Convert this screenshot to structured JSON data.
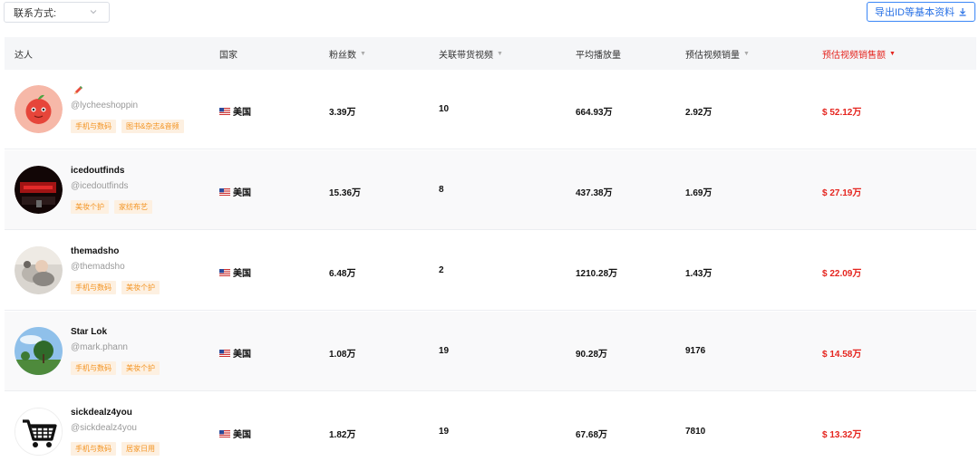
{
  "filter": {
    "contact_label": "联系方式:"
  },
  "export_label": "导出ID等基本资料",
  "columns": [
    {
      "label": "达人",
      "sortable": false
    },
    {
      "label": "国家",
      "sortable": false
    },
    {
      "label": "粉丝数",
      "sortable": true
    },
    {
      "label": "关联带货视频",
      "sortable": true
    },
    {
      "label": "平均播放量",
      "sortable": false
    },
    {
      "label": "预估视频销量",
      "sortable": true
    },
    {
      "label": "预估视频销售额",
      "sortable": true,
      "active": true
    }
  ],
  "sort_glyph": "▼",
  "rows": [
    {
      "name": "",
      "name_icon": "pencil-emoji-icon",
      "handle": "@lycheeshoppin",
      "tags": [
        "手机与数码",
        "图书&杂志&音频"
      ],
      "country": "美国",
      "followers": "3.39万",
      "videos": "10",
      "avg_views": "664.93万",
      "est_sales": "2.92万",
      "est_revenue": "$ 52.12万",
      "avatar": "lychee-avatar"
    },
    {
      "name": "icedoutfinds",
      "handle": "@icedoutfinds",
      "tags": [
        "美妆个护",
        "家纺布艺"
      ],
      "country": "美国",
      "followers": "15.36万",
      "videos": "8",
      "avg_views": "437.38万",
      "est_sales": "1.69万",
      "est_revenue": "$ 27.19万",
      "avatar": "dark-room-avatar"
    },
    {
      "name": "themadsho",
      "handle": "@themadsho",
      "tags": [
        "手机与数码",
        "美妆个护"
      ],
      "country": "美国",
      "followers": "6.48万",
      "videos": "2",
      "avg_views": "1210.28万",
      "est_sales": "1.43万",
      "est_revenue": "$ 22.09万",
      "avatar": "person-avatar"
    },
    {
      "name": "Star Lok",
      "handle": "@mark.phann",
      "tags": [
        "手机与数码",
        "美妆个护"
      ],
      "country": "美国",
      "followers": "1.08万",
      "videos": "19",
      "avg_views": "90.28万",
      "est_sales": "9176",
      "est_revenue": "$ 14.58万",
      "avatar": "landscape-avatar"
    },
    {
      "name": "sickdealz4you",
      "handle": "@sickdealz4you",
      "tags": [
        "手机与数码",
        "居家日用"
      ],
      "country": "美国",
      "followers": "1.82万",
      "videos": "19",
      "avg_views": "67.68万",
      "est_sales": "7810",
      "est_revenue": "$ 13.32万",
      "avatar": "cart-avatar"
    }
  ],
  "colors": {
    "accent_red": "#e5251f",
    "tag_bg": "#fdf0e1",
    "tag_text": "#f39423",
    "link_blue": "#2a72e6"
  }
}
